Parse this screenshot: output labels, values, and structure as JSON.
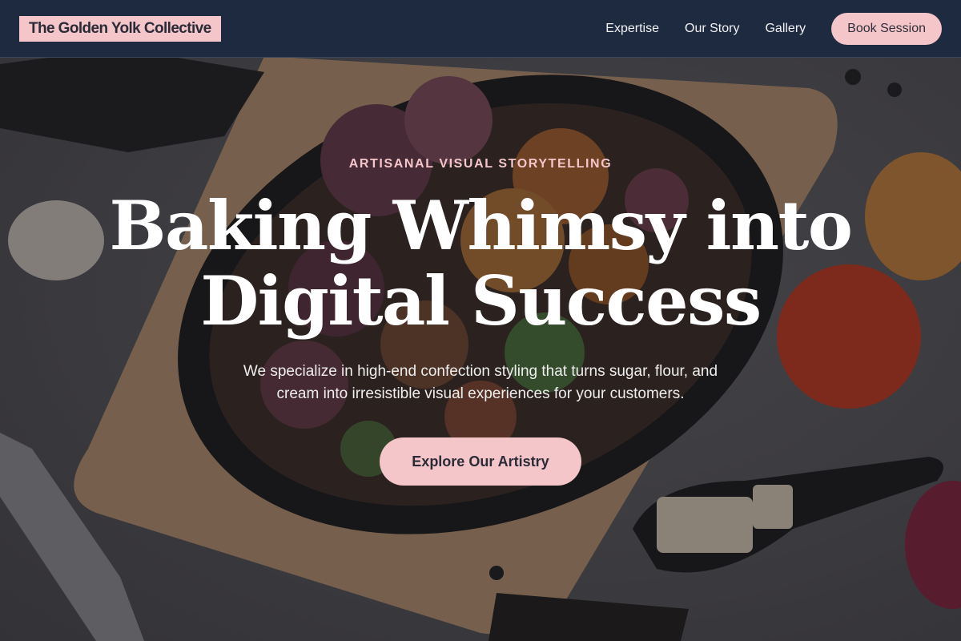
{
  "brand": {
    "name": "The Golden Yolk Collective",
    "accent_color": "#f4c5c9",
    "nav_color": "#1e2a3f"
  },
  "nav": {
    "links": [
      {
        "label": "Expertise"
      },
      {
        "label": "Our Story"
      },
      {
        "label": "Gallery"
      }
    ],
    "cta_label": "Book Session"
  },
  "hero": {
    "eyebrow": "Artisanal Visual Storytelling",
    "headline_line1": "Baking Whimsy into",
    "headline_line2": "Digital Success",
    "subtext_line1": "We specialize in high-end confection styling that turns sugar, flour, and",
    "subtext_line2": "cream into irresistible visual experiences for your customers.",
    "cta_label": "Explore Our Artistry",
    "background_image": "food-flatlay-photo"
  }
}
